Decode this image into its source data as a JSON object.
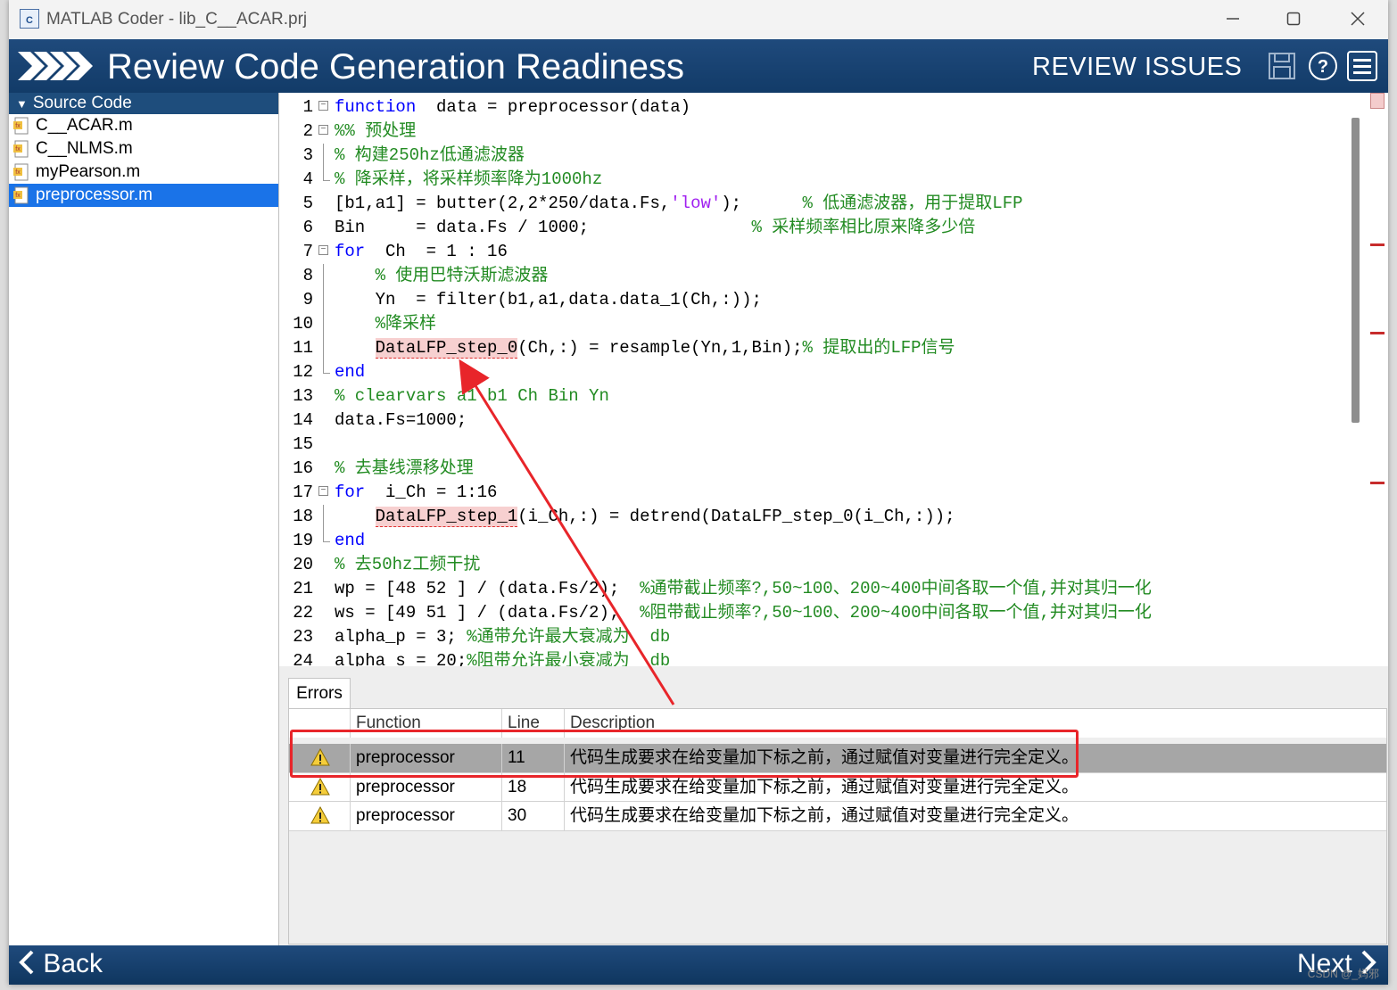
{
  "window": {
    "title": "MATLAB Coder - lib_C__ACAR.prj",
    "app_icon": "matlab-coder-icon",
    "controls": [
      "minimize",
      "maximize",
      "close"
    ]
  },
  "header": {
    "title": "Review Code Generation Readiness",
    "section": "REVIEW ISSUES",
    "icons": [
      "save-icon",
      "help-icon",
      "menu-icon"
    ],
    "background": "#1f4a7c"
  },
  "sidebar": {
    "heading": "Source Code",
    "files": [
      {
        "name": "C__ACAR.m",
        "selected": false
      },
      {
        "name": "C__NLMS.m",
        "selected": false
      },
      {
        "name": "myPearson.m",
        "selected": false
      },
      {
        "name": "preprocessor.m",
        "selected": true
      }
    ],
    "selected_color": "#1a73e8"
  },
  "code": {
    "lines": [
      {
        "n": "1",
        "fold": "box",
        "segs": [
          [
            "kw",
            "function"
          ],
          [
            "",
            "  data = preprocessor(data)"
          ]
        ]
      },
      {
        "n": "2",
        "fold": "box",
        "segs": [
          [
            "cm",
            "%% 预处理"
          ]
        ]
      },
      {
        "n": "3",
        "fold": "line",
        "segs": [
          [
            "cm",
            "% 构建250hz低通滤波器"
          ]
        ]
      },
      {
        "n": "4",
        "fold": "end",
        "segs": [
          [
            "cm",
            "% 降采样，将采样频率降为1000hz"
          ]
        ]
      },
      {
        "n": "5",
        "fold": "",
        "segs": [
          [
            "",
            "[b1,a1] = butter(2,2*250/data.Fs,"
          ],
          [
            "st",
            "'low'"
          ],
          [
            "",
            ");      "
          ],
          [
            "cm",
            "% 低通滤波器，用于提取LFP"
          ]
        ]
      },
      {
        "n": "6",
        "fold": "",
        "segs": [
          [
            "",
            "Bin     = data.Fs / 1000;                "
          ],
          [
            "cm",
            "% 采样频率相比原来降多少倍"
          ]
        ]
      },
      {
        "n": "7",
        "fold": "box",
        "segs": [
          [
            "kw",
            "for"
          ],
          [
            "",
            "  Ch  = 1 : 16"
          ]
        ]
      },
      {
        "n": "8",
        "fold": "line",
        "segs": [
          [
            "",
            "    "
          ],
          [
            "cm",
            "% 使用巴特沃斯滤波器"
          ]
        ]
      },
      {
        "n": "9",
        "fold": "line",
        "segs": [
          [
            "",
            "    Yn  = filter(b1,a1,data.data_1(Ch,:));"
          ]
        ]
      },
      {
        "n": "10",
        "fold": "line",
        "segs": [
          [
            "",
            "    "
          ],
          [
            "cm",
            "%降采样"
          ]
        ]
      },
      {
        "n": "11",
        "fold": "line",
        "segs": [
          [
            "",
            "    "
          ],
          [
            "err",
            "DataLFP_step_0"
          ],
          [
            "",
            "(Ch,:) = resample(Yn,1,Bin);"
          ],
          [
            "cm",
            "% 提取出的LFP信号"
          ]
        ]
      },
      {
        "n": "12",
        "fold": "end",
        "segs": [
          [
            "kw",
            "end"
          ]
        ]
      },
      {
        "n": "13",
        "fold": "",
        "segs": [
          [
            "cm",
            "% clearvars a1 b1 Ch Bin Yn"
          ]
        ]
      },
      {
        "n": "14",
        "fold": "",
        "segs": [
          [
            "",
            "data.Fs=1000;"
          ]
        ]
      },
      {
        "n": "15",
        "fold": "",
        "segs": [
          [
            "",
            ""
          ]
        ]
      },
      {
        "n": "16",
        "fold": "",
        "segs": [
          [
            "cm",
            "% 去基线漂移处理"
          ]
        ]
      },
      {
        "n": "17",
        "fold": "box",
        "segs": [
          [
            "kw",
            "for"
          ],
          [
            "",
            "  i_Ch = 1:16"
          ]
        ]
      },
      {
        "n": "18",
        "fold": "line",
        "segs": [
          [
            "",
            "    "
          ],
          [
            "err",
            "DataLFP_step_1"
          ],
          [
            "",
            "(i_Ch,:) = detrend(DataLFP_step_0(i_Ch,:));"
          ]
        ]
      },
      {
        "n": "19",
        "fold": "end",
        "segs": [
          [
            "kw",
            "end"
          ]
        ]
      },
      {
        "n": "20",
        "fold": "",
        "segs": [
          [
            "cm",
            "% 去50hz工频干扰"
          ]
        ]
      },
      {
        "n": "21",
        "fold": "",
        "segs": [
          [
            "",
            "wp = [48 52 ] / (data.Fs/2);  "
          ],
          [
            "cm",
            "%通带截止频率?,50~100、200~400中间各取一个值,并对其归一化"
          ]
        ]
      },
      {
        "n": "22",
        "fold": "",
        "segs": [
          [
            "",
            "ws = [49 51 ] / (data.Fs/2);  "
          ],
          [
            "cm",
            "%阻带截止频率?,50~100、200~400中间各取一个值,并对其归一化"
          ]
        ]
      },
      {
        "n": "23",
        "fold": "",
        "segs": [
          [
            "",
            "alpha_p = 3; "
          ],
          [
            "cm",
            "%通带允许最大衰减为  db"
          ]
        ]
      },
      {
        "n": "24",
        "fold": "",
        "segs": [
          [
            "",
            "alpha_s = 20;"
          ],
          [
            "cm",
            "%阻带允许最小衰减为  db"
          ]
        ]
      }
    ],
    "colors": {
      "keyword": "#0000ff",
      "comment": "#228b22",
      "string": "#a020f0",
      "error_bg": "#f7d0d0"
    }
  },
  "errors": {
    "tab_label": "Errors",
    "columns": {
      "function": "Function",
      "line": "Line",
      "description": "Description"
    },
    "rows": [
      {
        "icon": "warning-icon",
        "function": "preprocessor",
        "line": "11",
        "description": "代码生成要求在给变量加下标之前，通过赋值对变量进行完全定义。",
        "selected": true
      },
      {
        "icon": "warning-icon",
        "function": "preprocessor",
        "line": "18",
        "description": "代码生成要求在给变量加下标之前，通过赋值对变量进行完全定义。",
        "selected": false
      },
      {
        "icon": "warning-icon",
        "function": "preprocessor",
        "line": "30",
        "description": "代码生成要求在给变量加下标之前，通过赋值对变量进行完全定义。",
        "selected": false
      }
    ],
    "selected_color": "#a6a6a6"
  },
  "footer": {
    "back_label": "Back",
    "next_label": "Next",
    "watermark": "CSDN @_妈邪"
  },
  "annotation_color": "#e8252a"
}
